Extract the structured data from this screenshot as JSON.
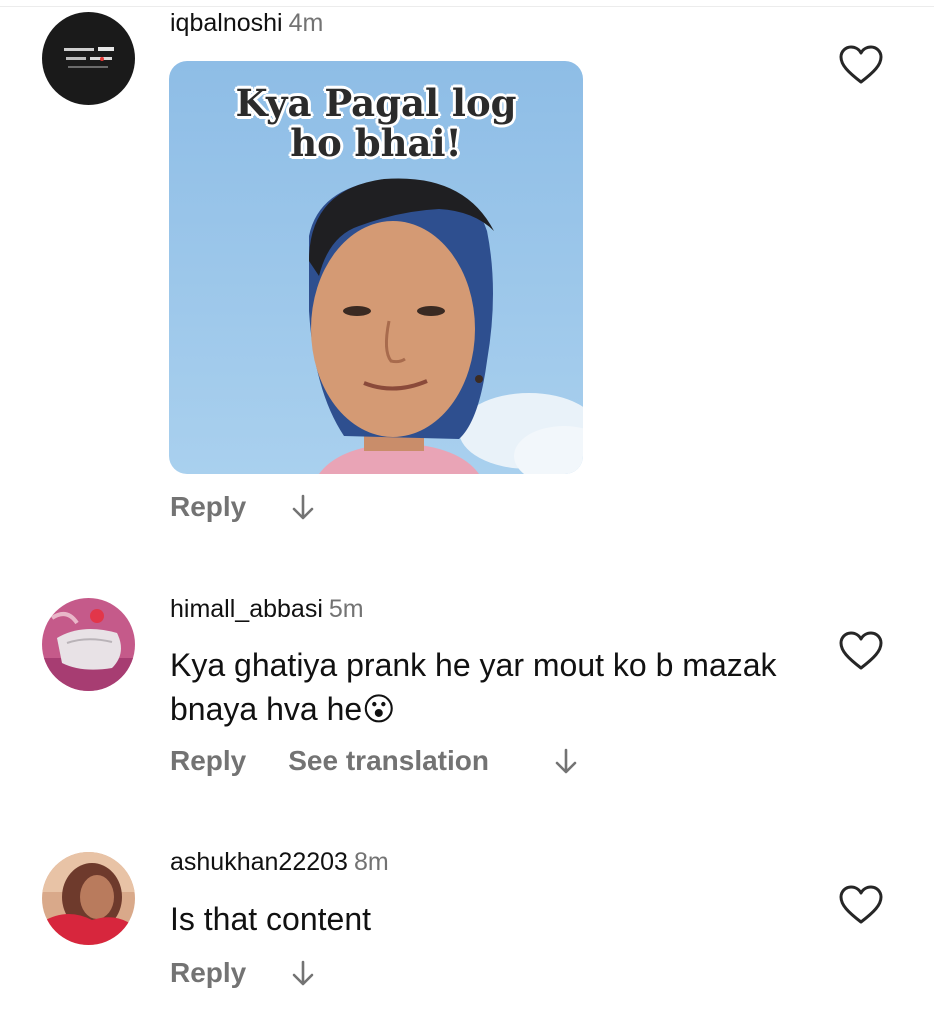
{
  "comments": [
    {
      "username": "iqbalnoshi",
      "time": "4m",
      "sticker": {
        "caption_line1": "Kya Pagal log",
        "caption_line2": "ho bhai!"
      },
      "reply_label": "Reply",
      "avatar_icon": "dark-poetry-avatar"
    },
    {
      "username": "himall_abbasi",
      "time": "5m",
      "text": "Kya ghatiya prank he yar mout ko b mazak bnaya hva he😮",
      "reply_label": "Reply",
      "translate_label": "See translation",
      "avatar_icon": "pink-photo-avatar"
    },
    {
      "username": "ashukhan22203",
      "time": "8m",
      "text": "Is that content",
      "reply_label": "Reply",
      "avatar_icon": "red-photo-avatar"
    }
  ],
  "icons": {
    "like": "heart-outline-icon",
    "more": "arrow-down-icon"
  },
  "colors": {
    "meta_text": "#737373",
    "primary_text": "#111111"
  }
}
